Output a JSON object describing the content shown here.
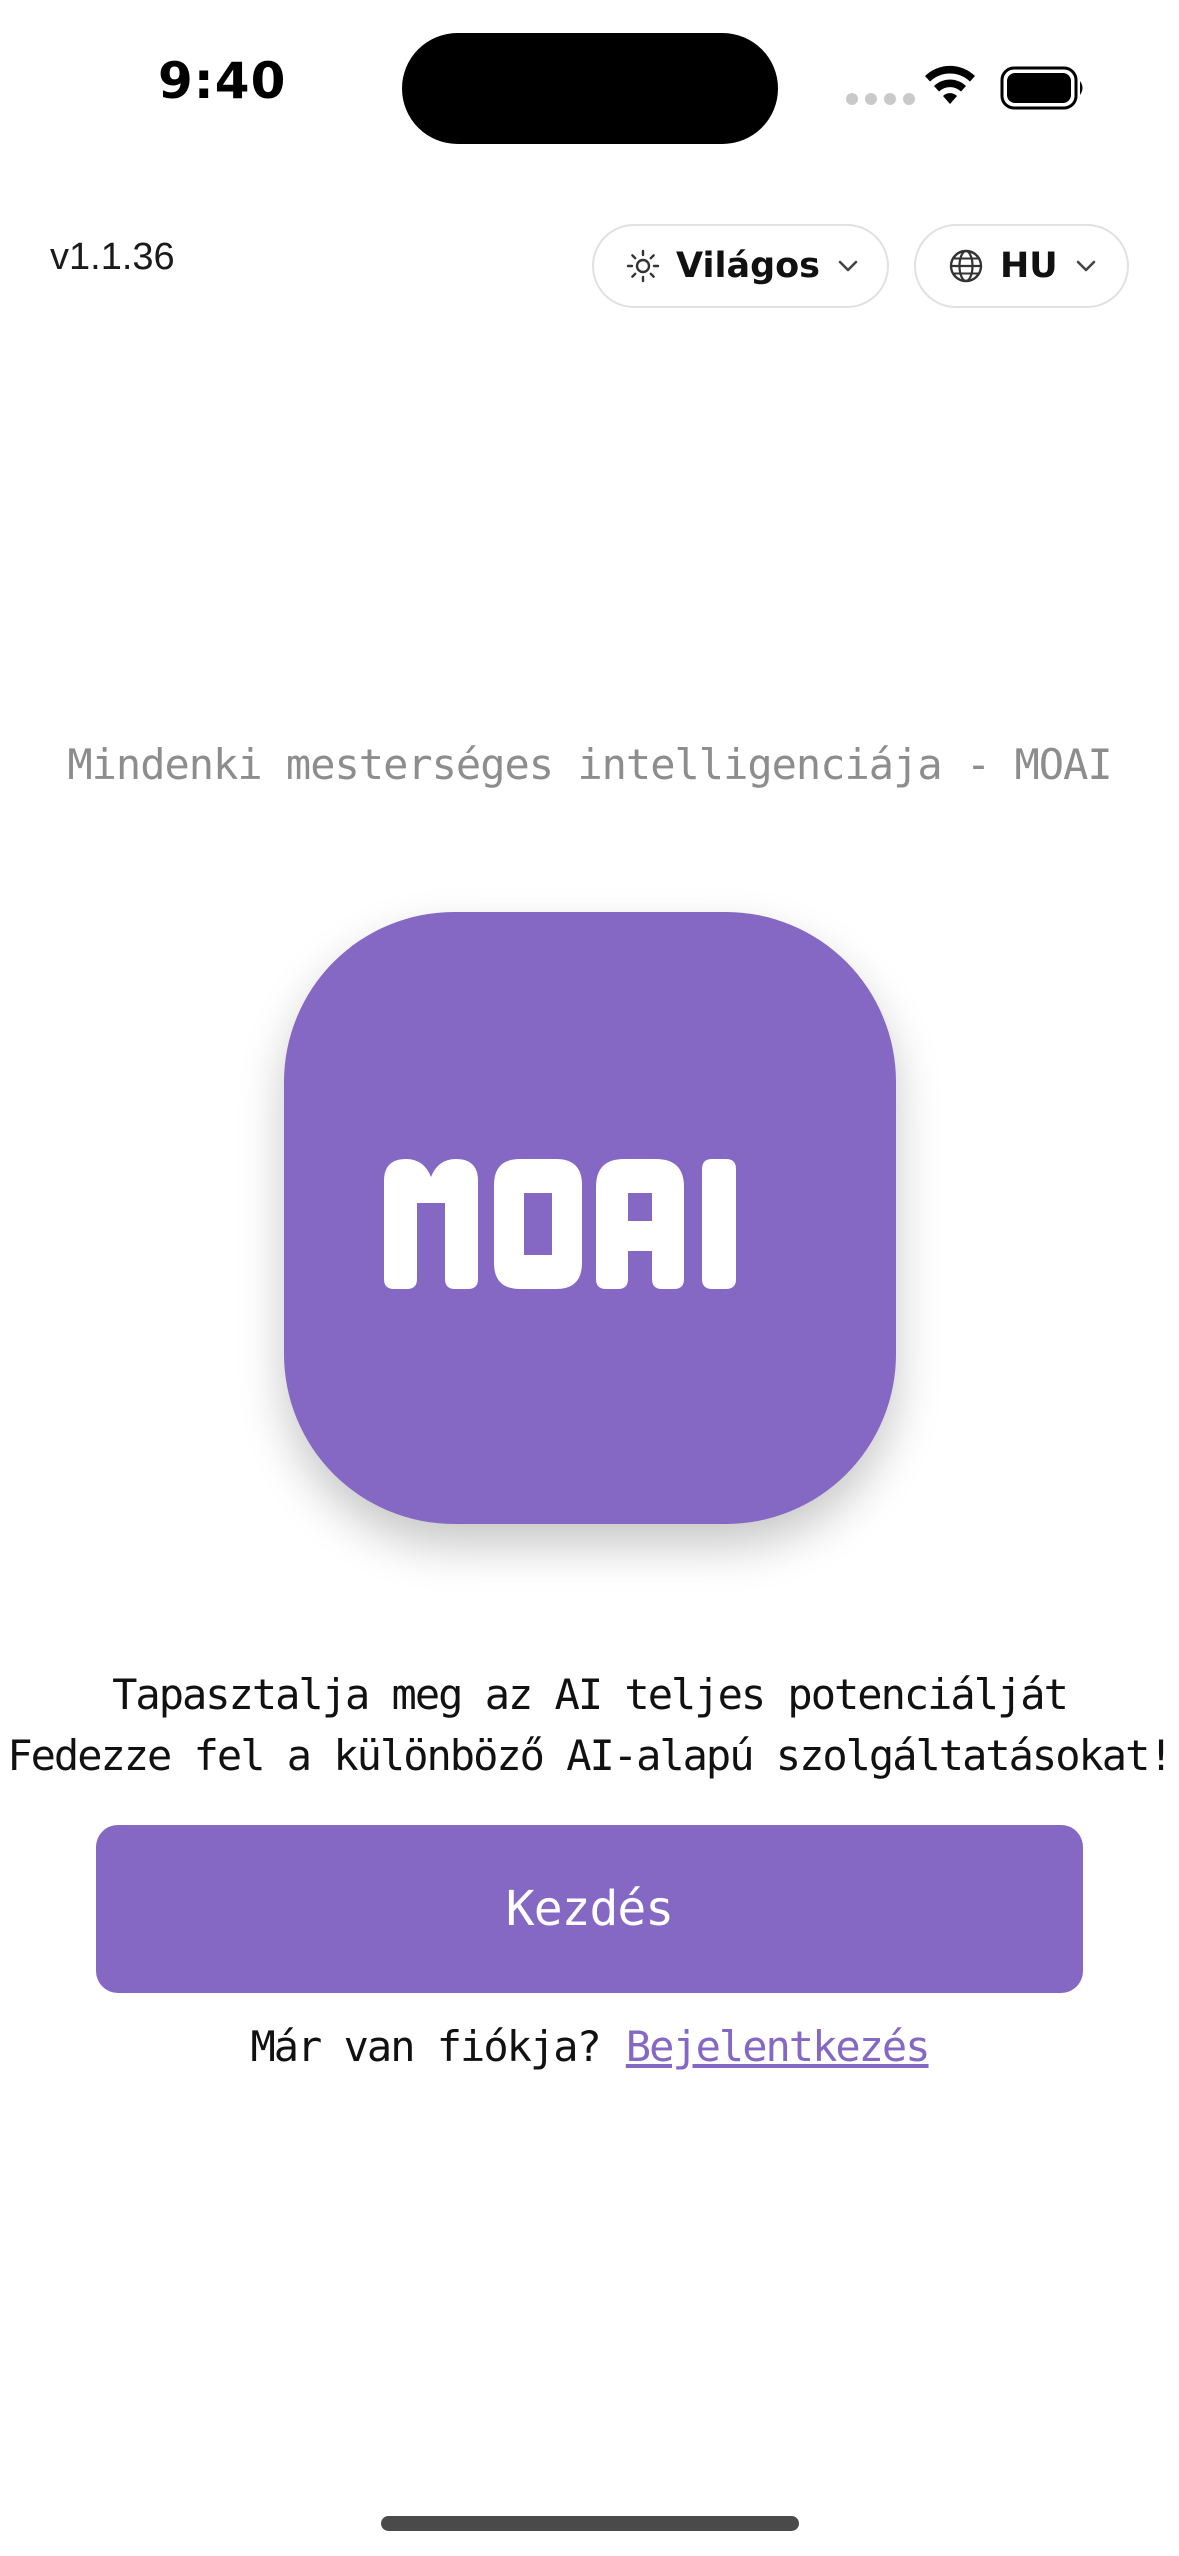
{
  "status_bar": {
    "time": "9:40"
  },
  "header": {
    "version": "v1.1.36",
    "theme_selector": {
      "label": "Világos",
      "icon": "sun-icon"
    },
    "language_selector": {
      "label": "HU",
      "icon": "globe-icon"
    }
  },
  "main": {
    "tagline": "Mindenki mesterséges intelligenciája - MOAI",
    "logo_text": "MOAI",
    "headline_line1": "Tapasztalja meg az AI teljes potenciálját",
    "headline_line2": "Fedezze fel a különböző AI-alapú szolgáltatásokat!",
    "start_button_label": "Kezdés",
    "login_prompt": "Már van fiókja?",
    "login_link_label": "Bejelentkezés"
  },
  "colors": {
    "accent": "#8567c4",
    "tagline_gray": "#8d8d8d"
  }
}
